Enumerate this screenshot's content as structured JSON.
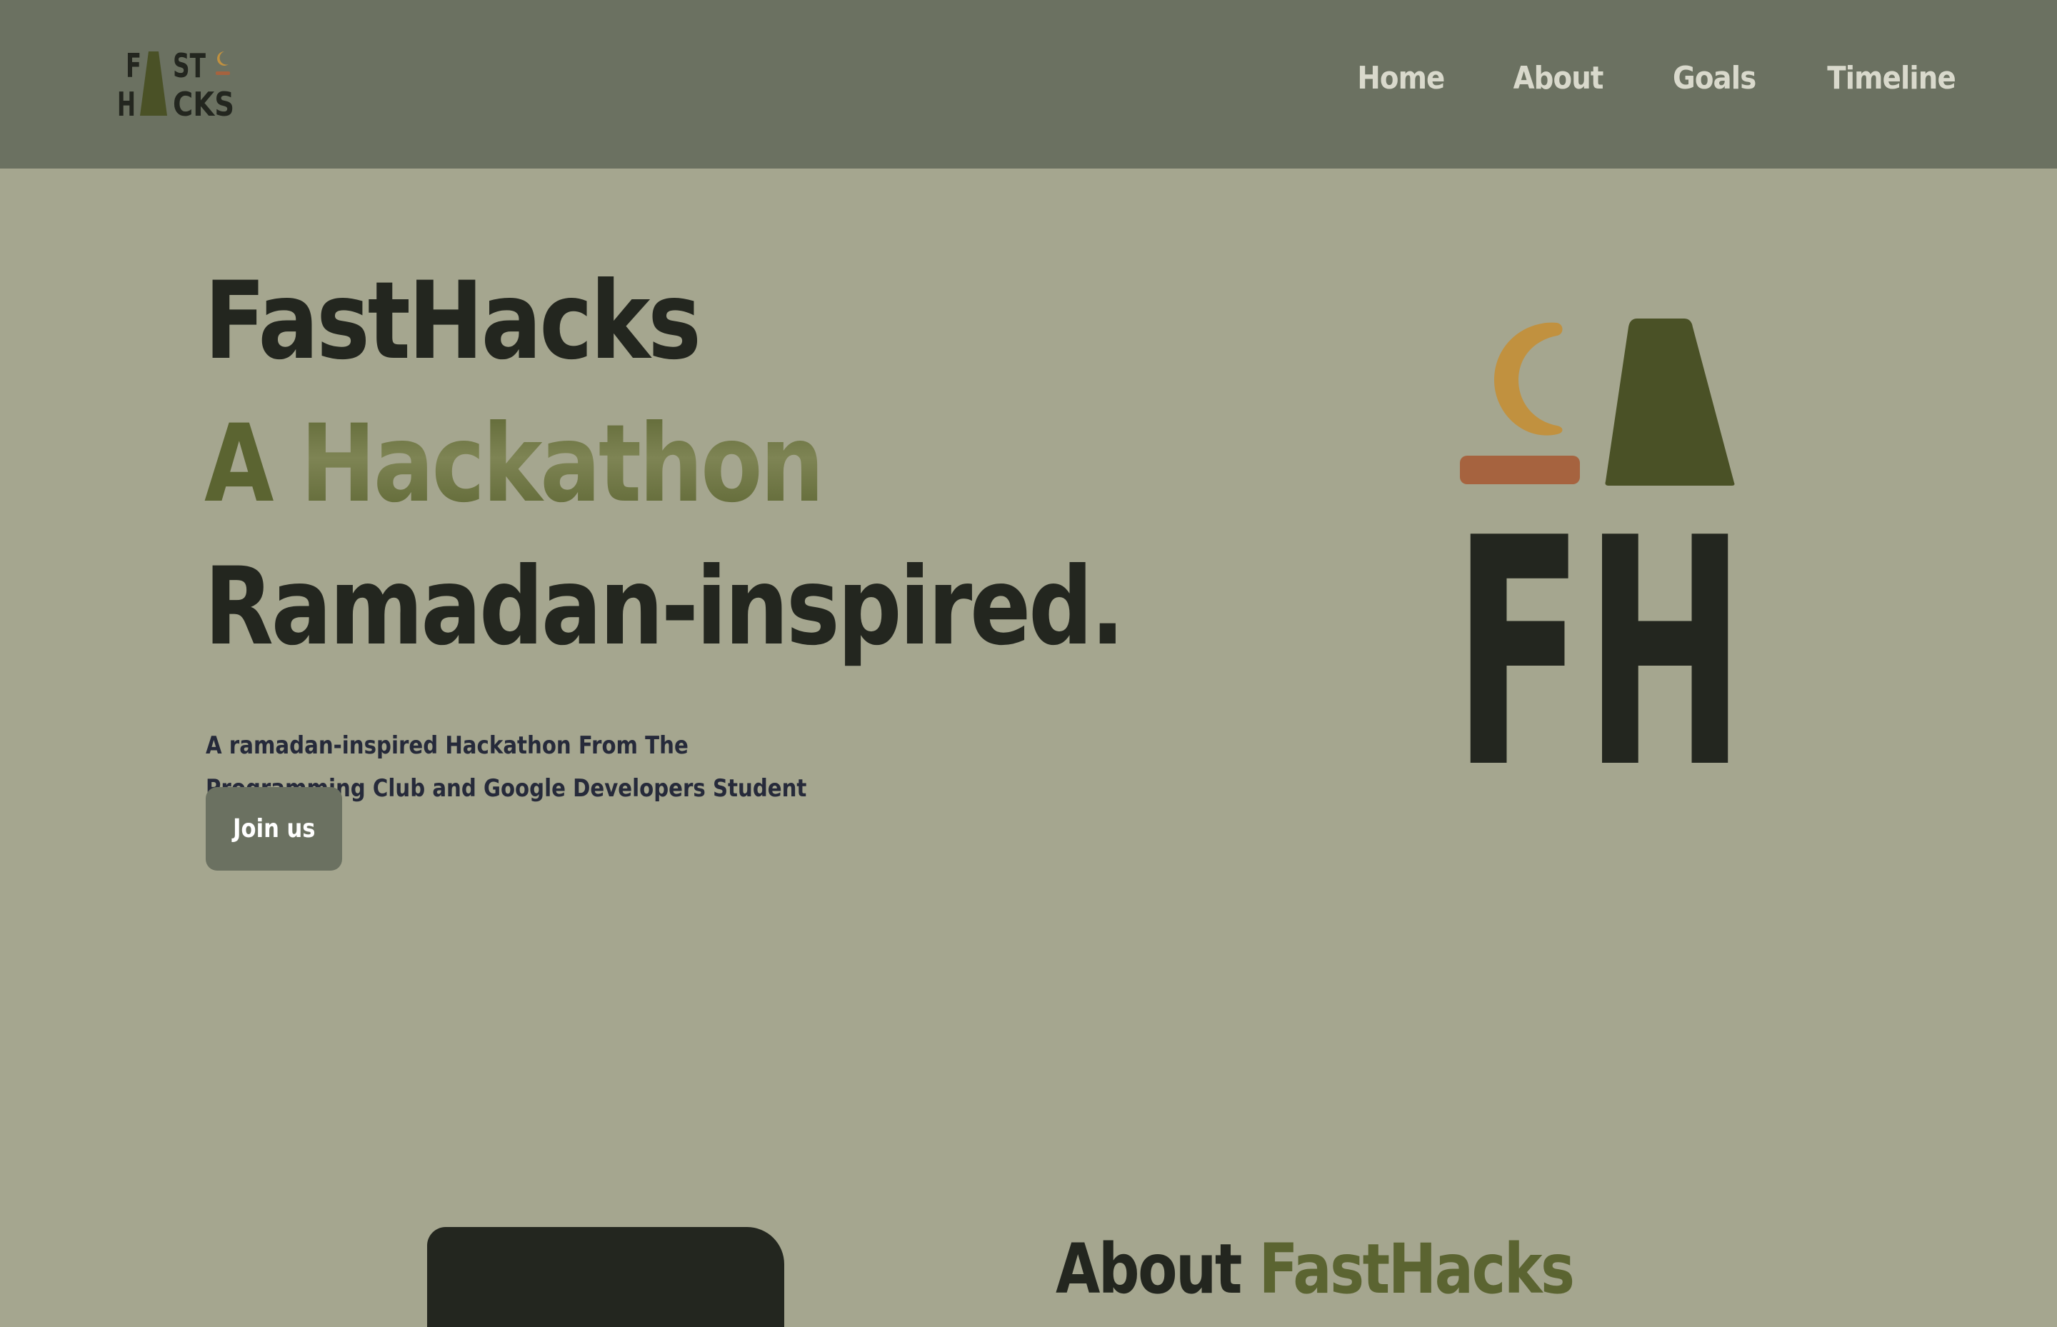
{
  "colors": {
    "background": "#a5a68f",
    "navbar": "#6b7161",
    "dark": "#23261f",
    "olive": "#4a5126",
    "moon": "#c1913f",
    "bar": "#a6633f",
    "nav_text": "#d9d9cc",
    "button_text": "#ffffff"
  },
  "logo": {
    "line1": "FAST",
    "line2": "HACKS",
    "icon": "fasthacks-logo"
  },
  "nav": {
    "items": [
      {
        "label": "Home"
      },
      {
        "label": "About"
      },
      {
        "label": "Goals"
      },
      {
        "label": "Timeline"
      }
    ]
  },
  "hero": {
    "title": "FastHacks",
    "tag_prefix": "A",
    "tag_word": "Hackathon",
    "subtitle": "Ramadan-inspired.",
    "description": "A ramadan-inspired Hackathon From The Programming Club and Google Developers Student Club in IAU",
    "cta_label": "Join us",
    "art_letters": "FH",
    "art_icons": [
      "crescent-moon-icon",
      "lantern-tower-icon"
    ]
  },
  "about": {
    "heading_prefix": "About",
    "heading_name": "FastHacks"
  }
}
